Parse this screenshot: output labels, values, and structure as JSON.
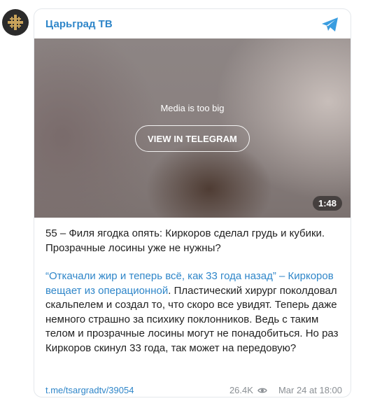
{
  "channel": {
    "name": "Царьград ТВ"
  },
  "media": {
    "message": "Media is too big",
    "button_label": "VIEW IN TELEGRAM",
    "duration": "1:48"
  },
  "post": {
    "title_line": "55 – Филя ягодка опять: Киркоров сделал грудь и кубики. Прозрачные лосины уже не нужны?",
    "quote_link": "“Откачали жир и теперь всё, как 33 года назад” – Киркоров вещает из операционной",
    "body_rest": ". Пластический хирург поколдовал скальпелем и создал то, что скоро все увидят. Теперь даже немного страшно за психику поклонников. Ведь с таким телом и прозрачные лосины могут не понадобиться. Но раз Киркоров скинул 33 года, так может на передовую?"
  },
  "footer": {
    "link": "t.me/tsargradtv/39054",
    "views": "26.4K",
    "timestamp": "Mar 24 at 18:00"
  },
  "colors": {
    "accent": "#2f86c9",
    "text": "#222222",
    "muted": "#8a8f94"
  },
  "icons": [
    "channel-avatar-cross-logo",
    "telegram-plane-icon",
    "eye-icon"
  ]
}
